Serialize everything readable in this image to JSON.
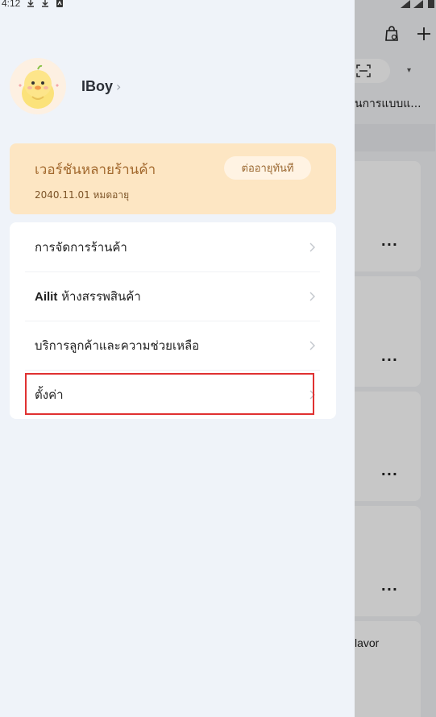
{
  "status_bar": {
    "time": "4:12"
  },
  "profile": {
    "username": "IBoy"
  },
  "membership": {
    "title": "เวอร์ชันหลายร้านค้า",
    "expire_text": "2040.11.01 หมดอายุ",
    "renew_label": "ต่ออายุทันที"
  },
  "menu": {
    "items": [
      {
        "label": "การจัดการร้านค้า"
      },
      {
        "brand": "Ailit",
        "label": " ห้างสรรพสินค้า"
      },
      {
        "label": "บริการลูกค้าและความช่วยเหลือ"
      },
      {
        "label": "ตั้งค่า"
      }
    ]
  },
  "background": {
    "tab_text": "นการแบบแ...",
    "more_label": "...",
    "flavor_text": "lavor"
  }
}
